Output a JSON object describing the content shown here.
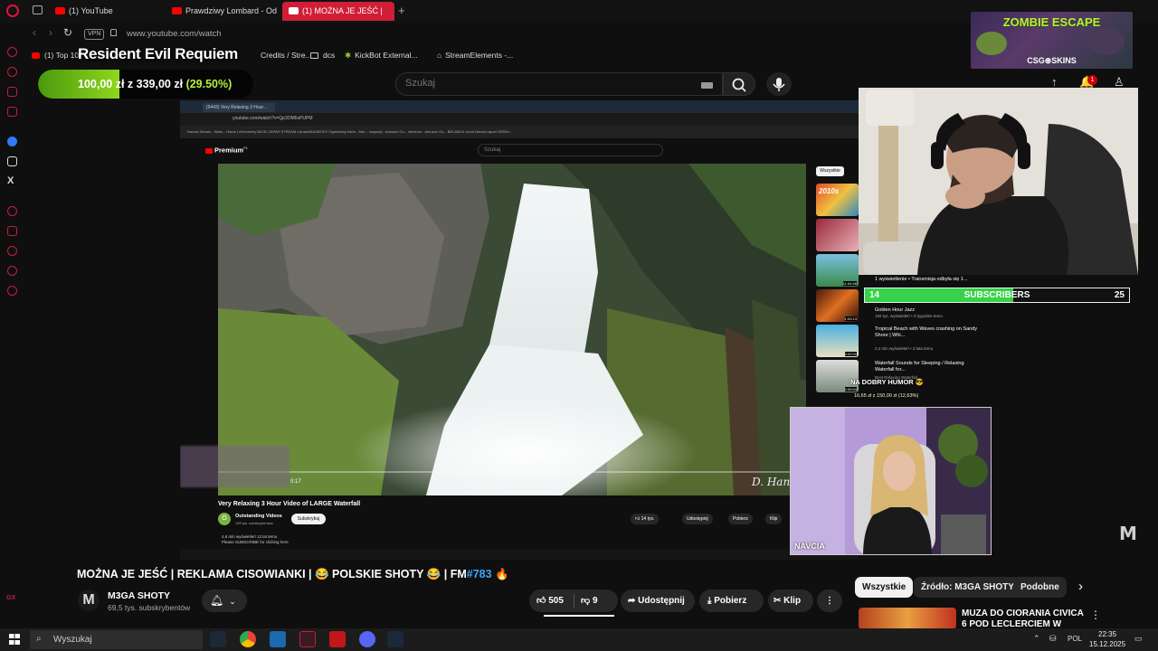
{
  "browser": {
    "tabs": [
      {
        "label": "(1) YouTube"
      },
      {
        "label": "Prawdziwy Lombard - Od"
      },
      {
        "label": "(1) MOŻNA JE JEŚĆ |"
      }
    ],
    "url": "www.youtube.com/watch",
    "vpn_label": "VPN",
    "bookmarks": [
      {
        "label": "(1) Top 10"
      },
      {
        "label": "Credits / Stre..."
      },
      {
        "label": "dcs"
      },
      {
        "label": "KickBot External..."
      },
      {
        "label": "StreamElements -..."
      }
    ],
    "sidebar_bottom_label": "GX"
  },
  "stream": {
    "overlay_title": "Resident Evil Requiem",
    "bankroll": {
      "current": "100,00 zł",
      "target": "339,00 zł",
      "percent": "(29.50%)",
      "progress_fraction": 0.295
    },
    "promo": {
      "title": "ZOMBIE ESCAPE",
      "sponsor": "CSG⊛SKINS"
    },
    "subs_goal": {
      "current": "14",
      "label": "SUBSCRIBERS",
      "target": "25",
      "progress_fraction": 0.56
    },
    "second_cam_label": "NAVCIA",
    "small_overlay": "NA DOBRY HUMOR 😎",
    "small_overlay_sub": "16,65 zł z 150,00 zł (12,63%)"
  },
  "youtube": {
    "search_placeholder": "Szukaj",
    "notification_count": "1",
    "video_title_main": "MOŻNA JE JEŚĆ | REKLAMA CISOWIANKI | 😂 POLSKIE SHOTY 😂 | FM",
    "video_title_tag": "#783",
    "video_title_end": " 🔥",
    "channel": {
      "initial": "M",
      "name": "M3GA SHOTY",
      "subs": "69,5 tys. subskrybentów"
    },
    "actions": {
      "likes": "505",
      "dislikes": "9",
      "share": "Udostępnij",
      "download": "Pobierz",
      "clip": "Klip",
      "more": "⋮"
    },
    "chips": [
      {
        "label": "Wszystkie"
      },
      {
        "label": "Źródło: M3GA SHOTY"
      },
      {
        "label": "Podobne"
      }
    ],
    "recommendation": {
      "title": "MUZA DO CIORANIA CIVICA 6 POD LECLERCIEM W LUBLINIE"
    }
  },
  "capture": {
    "tab_label": "(9443) Very Relaxing 3 Hour...",
    "url": "youtube.com/watch?v=Qp3OM5xPUPM",
    "bookmarks_row": "Navcia Stream - Wats...   Home | eDeeeeely   BAJKI ZAPAS STREAM   Canals/MAGBODY   Ogarniamy hahe - Arte...   nagrody - Arkusze Go...   weeluhu - Arkusze Go...   BELABOX cloud   Navcia raport OBSKu...",
    "premium_label": "Premium",
    "premium_sup": "PL",
    "search": "Szukaj",
    "time": "0:17",
    "watermark": "D. Hans",
    "video_title": "Very Relaxing 3 Hour Video of LARGE Waterfall",
    "channel_initial": "O",
    "channel_name": "Outstanding Videos",
    "channel_subs": "199 tys. subskrybentów",
    "subscribe": "Subskrybuj",
    "likes": "14 tys.",
    "share": "Udostępnij",
    "download": "Pobierz",
    "clip": "Klip",
    "desc_line1": "4,6 mln wyświetleń  13 lat temu",
    "desc_line2": "Please SUBSCRIBE for clicking here",
    "chip": "Wszystkie",
    "rail": [
      {
        "title": "1 wyświetlenie • Transmisja odbyła się 1..."
      },
      {
        "title": "Golden Hour Jazz",
        "meta": "192 tys. wyświetleń • 3 tygodnie temu"
      },
      {
        "title": "Tropical Beach with Waves crashing on Sandy Shore | Whi...",
        "meta": "2,4 mln wyświetleń • 3 lata temu"
      },
      {
        "title": "Waterfall Sounds for Sleeping / Relaxing Waterfall for...",
        "meta": "Best Relaxing Waterfall"
      }
    ],
    "thumb_labels": [
      "2010s",
      "11:54:56",
      "1:00:13",
      "3:32:01",
      "2:59:54"
    ]
  },
  "taskbar": {
    "search_label": "Wyszukaj",
    "lang": "POL",
    "time": "22:35",
    "date": "15.12.2025"
  }
}
